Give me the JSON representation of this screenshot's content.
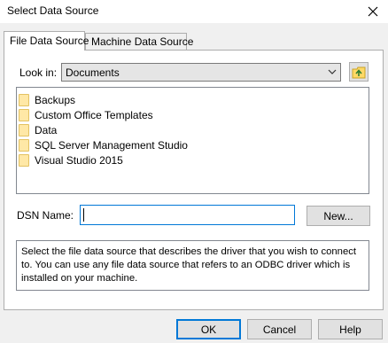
{
  "window": {
    "title": "Select Data Source"
  },
  "tabs": [
    {
      "label": "File Data Source",
      "active": true
    },
    {
      "label": "Machine Data Source",
      "active": false
    }
  ],
  "look_in": {
    "label": "Look in:",
    "value": "Documents"
  },
  "list": {
    "items": [
      {
        "label": "Backups",
        "icon": "folder-icon"
      },
      {
        "label": "Custom Office Templates",
        "icon": "folder-icon"
      },
      {
        "label": "Data",
        "icon": "folder-icon"
      },
      {
        "label": "SQL Server Management Studio",
        "icon": "folder-icon"
      },
      {
        "label": "Visual Studio 2015",
        "icon": "folder-icon"
      }
    ]
  },
  "dsn": {
    "label": "DSN Name:",
    "value": ""
  },
  "buttons": {
    "new": "New...",
    "ok": "OK",
    "cancel": "Cancel",
    "help": "Help"
  },
  "description": "Select the file data source that describes the driver that you wish to connect to. You can use any file data source that refers to an ODBC driver which is installed on your machine.",
  "colors": {
    "accent": "#0078d7",
    "folder": "#ffe8a6"
  }
}
